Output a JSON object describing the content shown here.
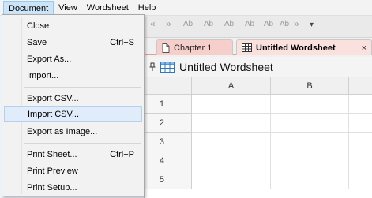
{
  "menubar": {
    "items": [
      {
        "label": "Document",
        "active": true
      },
      {
        "label": "View"
      },
      {
        "label": "Wordsheet"
      },
      {
        "label": "Help"
      }
    ]
  },
  "toolbar": {
    "buttons": [
      "Ab",
      "Ab",
      "Ab",
      "Ab",
      "Ab",
      "Ab"
    ]
  },
  "tabs": [
    {
      "label": "Chapter 1",
      "icon": "page-icon",
      "active": false
    },
    {
      "label": "Untitled Wordsheet",
      "icon": "table-icon",
      "active": true,
      "close": "×"
    }
  ],
  "document": {
    "pin": "pin-icon",
    "title": "Untitled Wordsheet"
  },
  "grid": {
    "columns": [
      "A",
      "B"
    ],
    "rows": [
      "1",
      "2",
      "3",
      "4",
      "5"
    ]
  },
  "dropdown": {
    "items": [
      {
        "label": "Close",
        "shortcut": ""
      },
      {
        "label": "Save",
        "shortcut": "Ctrl+S"
      },
      {
        "label": "Export As...",
        "shortcut": ""
      },
      {
        "label": "Import...",
        "shortcut": ""
      },
      {
        "label": "Export CSV...",
        "shortcut": ""
      },
      {
        "label": "Import CSV...",
        "shortcut": "",
        "highlighted": true
      },
      {
        "label": "Export as Image...",
        "shortcut": ""
      },
      {
        "label": "Print Sheet...",
        "shortcut": "Ctrl+P"
      },
      {
        "label": "Print Preview",
        "shortcut": ""
      },
      {
        "label": "Print Setup...",
        "shortcut": ""
      }
    ]
  },
  "colors": {
    "tab_active": "#fbe1de",
    "tab_inactive": "#f7cfca",
    "menu_highlight": "#e1ecfa",
    "accent_blue": "#2b78c5"
  }
}
